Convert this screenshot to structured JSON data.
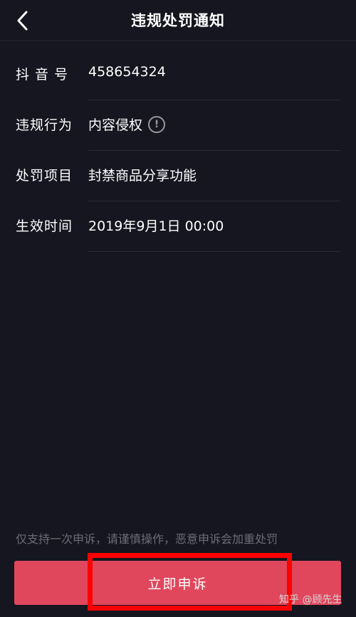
{
  "header": {
    "back_icon": "chevron-left-icon",
    "title": "违规处罚通知"
  },
  "details": [
    {
      "label": "抖 音 号",
      "value": "458654324"
    },
    {
      "label": "违规行为",
      "value": "内容侵权",
      "icon": "info-icon",
      "icon_glyph": "!"
    },
    {
      "label": "处罚项目",
      "value": "封禁商品分享功能"
    },
    {
      "label": "生效时间",
      "value": "2019年9月1日 00:00"
    }
  ],
  "notice": "仅支持一次申诉，请谨慎操作，恶意申诉会加重处罚",
  "appeal_button": {
    "label": "立即申诉"
  },
  "watermark": "知乎 @顾先生",
  "colors": {
    "background": "#15161f",
    "accent": "#e0475c",
    "annotation": "#ff0000"
  }
}
